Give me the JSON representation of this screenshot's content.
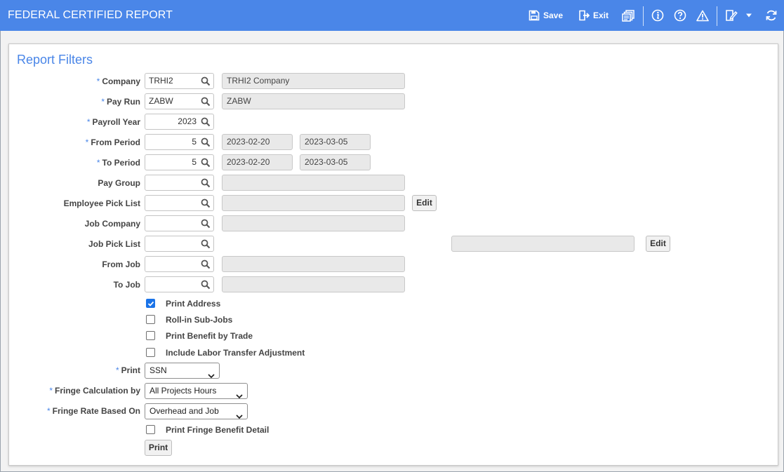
{
  "app": {
    "title": "FEDERAL CERTIFIED REPORT",
    "accent_color": "#4a86e8"
  },
  "toolbar": {
    "save_label": "Save",
    "exit_label": "Exit",
    "icons": [
      "save-icon",
      "exit-icon",
      "reports-icon",
      "info-icon",
      "help-icon",
      "warning-icon",
      "note-icon",
      "dropdown-caret-icon",
      "refresh-icon"
    ]
  },
  "panel": {
    "title": "Report Filters"
  },
  "fields": {
    "company": {
      "label": "Company",
      "value": "TRHI2",
      "description": "TRHI2 Company",
      "required": true
    },
    "pay_run": {
      "label": "Pay Run",
      "value": "ZABW",
      "description": "ZABW",
      "required": true
    },
    "payroll_year": {
      "label": "Payroll Year",
      "value": "2023",
      "required": true
    },
    "from_period": {
      "label": "From Period",
      "value": "5",
      "start_date": "2023-02-20",
      "end_date": "2023-03-05",
      "required": true
    },
    "to_period": {
      "label": "To Period",
      "value": "5",
      "start_date": "2023-02-20",
      "end_date": "2023-03-05",
      "required": true
    },
    "pay_group": {
      "label": "Pay Group",
      "value": "",
      "description": ""
    },
    "employee_pick_list": {
      "label": "Employee Pick List",
      "value": "",
      "description": "",
      "edit_label": "Edit"
    },
    "job_company": {
      "label": "Job Company",
      "value": "",
      "description": ""
    },
    "job_pick_list": {
      "label": "Job Pick List",
      "value": "",
      "description": "",
      "edit_label": "Edit"
    },
    "from_job": {
      "label": "From Job",
      "value": "",
      "description": ""
    },
    "to_job": {
      "label": "To Job",
      "value": "",
      "description": ""
    }
  },
  "checkboxes": {
    "print_address": {
      "label": "Print Address",
      "checked": true
    },
    "roll_in_sub_jobs": {
      "label": "Roll-in Sub-Jobs",
      "checked": false
    },
    "print_benefit_by_trade": {
      "label": "Print Benefit by Trade",
      "checked": false
    },
    "include_labor_transfer": {
      "label": "Include Labor Transfer Adjustment",
      "checked": false
    },
    "print_fringe_benefit_detail": {
      "label": "Print Fringe Benefit Detail",
      "checked": false
    }
  },
  "selects": {
    "print": {
      "label": "Print",
      "value": "SSN",
      "required": true
    },
    "fringe_calculation_by": {
      "label": "Fringe Calculation by",
      "value": "All Projects Hours",
      "required": true
    },
    "fringe_rate_based_on": {
      "label": "Fringe Rate Based On",
      "value": "Overhead and Job",
      "required": true
    }
  },
  "print_button_label": "Print"
}
